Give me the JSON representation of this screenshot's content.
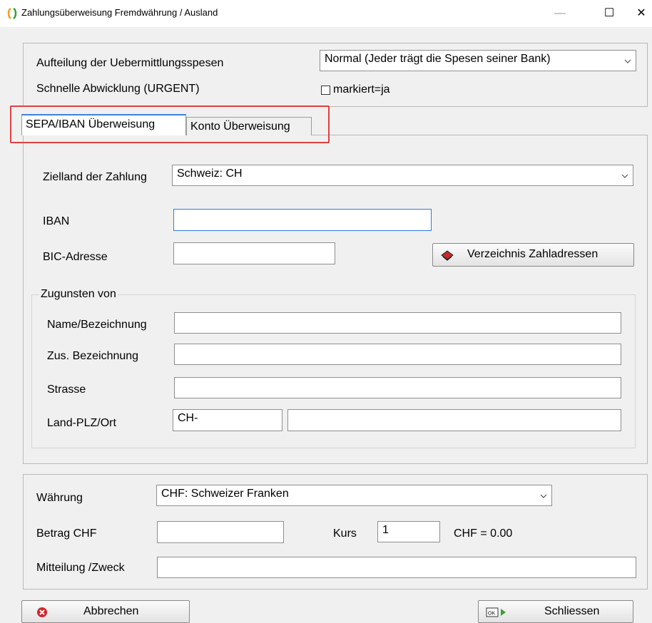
{
  "window": {
    "title": "Zahlungsüberweisung Fremdwährung / Ausland",
    "minimize": "—",
    "maximize": "☐",
    "close": "✕"
  },
  "top": {
    "spesen_label": "Aufteilung der Uebermittlungsspesen",
    "spesen_value": "Normal (Jeder trägt die Spesen seiner Bank)",
    "urgent_label": "Schnelle Abwicklung (URGENT)",
    "urgent_checkbox_label": "markiert=ja"
  },
  "tabs": [
    {
      "label": "SEPA/IBAN Überweisung"
    },
    {
      "label": "Konto Überweisung"
    }
  ],
  "sepa": {
    "zielland_label": "Zielland der Zahlung",
    "zielland_value": "Schweiz: CH",
    "iban_label": "IBAN",
    "iban_value": "",
    "bic_label": "BIC-Adresse",
    "bic_value": "",
    "verzeichnis_button": "Verzeichnis Zahladressen",
    "zugunsten_label": "Zugunsten von",
    "name_label": "Name/Bezeichnung",
    "zusbez_label": "Zus. Bezeichnung",
    "strasse_label": "Strasse",
    "landplz_label": "Land-PLZ/Ort",
    "land_value": "CH-",
    "ort_value": ""
  },
  "bottom": {
    "waehrung_label": "Währung",
    "waehrung_value": "CHF: Schweizer Franken",
    "betrag_label": "Betrag  CHF",
    "kurs_label": "Kurs",
    "kurs_value": "1",
    "chf_result": "CHF = 0.00",
    "mitteilung_label": "Mitteilung /Zweck"
  },
  "buttons": {
    "cancel": "Abbrechen",
    "close": "Schliessen"
  },
  "colors": {
    "highlight": "#e04040",
    "active_tab_accent": "#3b84d7",
    "cancel_icon": "#d6242b",
    "ok_arrow": "#3aa033"
  }
}
